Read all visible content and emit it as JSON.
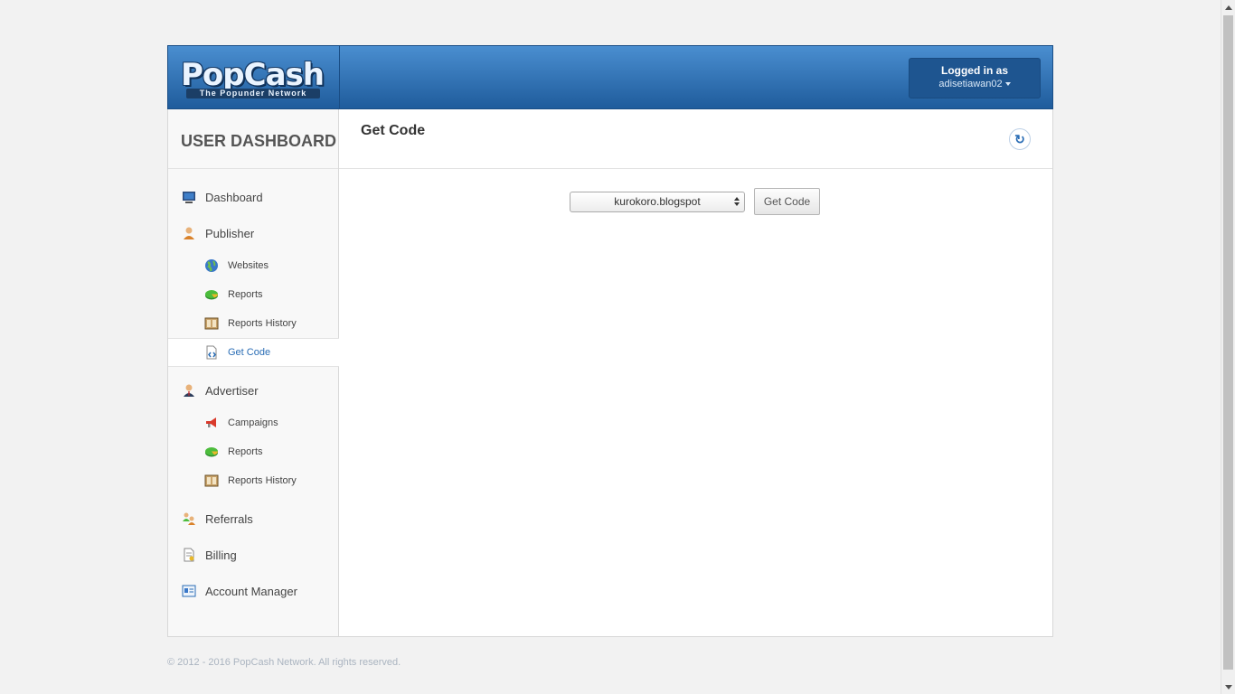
{
  "brand": {
    "logo_text": "PopCash",
    "tagline": "The Popunder Network"
  },
  "header": {
    "user_title": "Logged in as",
    "username": "adisetiawan02"
  },
  "sidebar": {
    "title": "USER DASHBOARD",
    "items": [
      {
        "label": "Dashboard",
        "icon": "monitor-icon",
        "level": "top"
      },
      {
        "label": "Publisher",
        "icon": "person-icon",
        "level": "top"
      },
      {
        "label": "Websites",
        "icon": "globe-icon",
        "level": "sub"
      },
      {
        "label": "Reports",
        "icon": "pie-chart-icon",
        "level": "sub"
      },
      {
        "label": "Reports History",
        "icon": "history-book-icon",
        "level": "sub"
      },
      {
        "label": "Get Code",
        "icon": "code-file-icon",
        "level": "sub",
        "active": true
      },
      {
        "label": "Advertiser",
        "icon": "businessman-icon",
        "level": "top"
      },
      {
        "label": "Campaigns",
        "icon": "megaphone-icon",
        "level": "sub"
      },
      {
        "label": "Reports",
        "icon": "pie-chart-icon",
        "level": "sub"
      },
      {
        "label": "Reports History",
        "icon": "history-book-icon",
        "level": "sub"
      },
      {
        "label": "Referrals",
        "icon": "people-icon",
        "level": "top"
      },
      {
        "label": "Billing",
        "icon": "invoice-icon",
        "level": "top"
      },
      {
        "label": "Account Manager",
        "icon": "id-card-icon",
        "level": "top"
      }
    ]
  },
  "main": {
    "title": "Get Code",
    "site_select": {
      "selected": "kurokoro.blogspot"
    },
    "get_code_button": "Get Code"
  },
  "footer": {
    "copyright": "© 2012 - 2016 PopCash Network. All rights reserved."
  },
  "colors": {
    "header_top": "#4a8ed0",
    "header_bottom": "#1f5c9c",
    "active_link": "#2a6db5"
  }
}
